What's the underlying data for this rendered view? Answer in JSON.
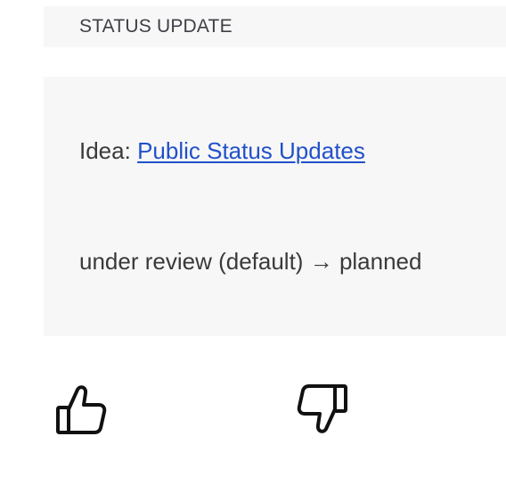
{
  "header": {
    "title": "STATUS UPDATE"
  },
  "update": {
    "idea_prefix": "Idea: ",
    "idea_link_label": "Public Status Updates",
    "status_from": "under review (default)",
    "arrow": "→",
    "status_to": "planned"
  },
  "votes": {
    "up_icon": "thumbs-up-icon",
    "down_icon": "thumbs-down-icon"
  },
  "colors": {
    "panel_bg": "#f7f7f7",
    "link": "#2150c9",
    "text": "#3a3a3a"
  }
}
